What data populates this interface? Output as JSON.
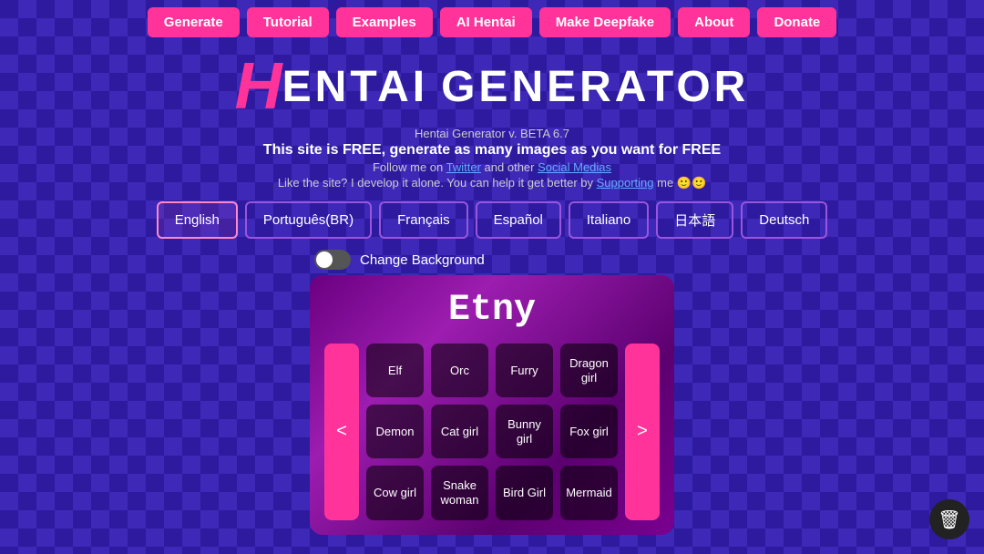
{
  "nav": {
    "buttons": [
      {
        "id": "generate",
        "label": "Generate"
      },
      {
        "id": "tutorial",
        "label": "Tutorial"
      },
      {
        "id": "examples",
        "label": "Examples"
      },
      {
        "id": "ai-hentai",
        "label": "AI Hentai"
      },
      {
        "id": "make-deepfake",
        "label": "Make Deepfake"
      },
      {
        "id": "about",
        "label": "About"
      },
      {
        "id": "donate",
        "label": "Donate"
      }
    ]
  },
  "title": {
    "h": "H",
    "rest": "ENTAI",
    "generator": "GENERATOR",
    "version": "Hentai Generator v. BETA 6.7",
    "free_text": "This site is FREE, generate as many images as you want for FREE",
    "follow_text": "Follow me on Twitter and other Social Medias",
    "support_text": "Like the site? I develop it alone. You can help it get better by Supporting me 🙂🙂"
  },
  "languages": [
    {
      "id": "english",
      "label": "English",
      "active": true
    },
    {
      "id": "portuguese-br",
      "label": "Português(BR)",
      "active": false
    },
    {
      "id": "french",
      "label": "Français",
      "active": false
    },
    {
      "id": "spanish",
      "label": "Español",
      "active": false
    },
    {
      "id": "italian",
      "label": "Italiano",
      "active": false
    },
    {
      "id": "japanese",
      "label": "日本語",
      "active": false
    },
    {
      "id": "deutsch",
      "label": "Deutsch",
      "active": false
    }
  ],
  "toggle": {
    "label": "Change Background"
  },
  "card": {
    "title": "Etny",
    "nav_left": "<",
    "nav_right": ">",
    "grid": [
      {
        "id": "elf",
        "label": "Elf"
      },
      {
        "id": "orc",
        "label": "Orc"
      },
      {
        "id": "furry",
        "label": "Furry"
      },
      {
        "id": "dragon-girl",
        "label": "Dragon girl"
      },
      {
        "id": "demon",
        "label": "Demon"
      },
      {
        "id": "cat-girl",
        "label": "Cat girl"
      },
      {
        "id": "bunny-girl",
        "label": "Bunny girl"
      },
      {
        "id": "fox-girl",
        "label": "Fox girl"
      },
      {
        "id": "cow-girl",
        "label": "Cow girl"
      },
      {
        "id": "snake-woman",
        "label": "Snake woman"
      },
      {
        "id": "bird-girl",
        "label": "Bird Girl"
      },
      {
        "id": "mermaid",
        "label": "Mermaid"
      }
    ]
  },
  "trash": {
    "icon": "🗑"
  }
}
